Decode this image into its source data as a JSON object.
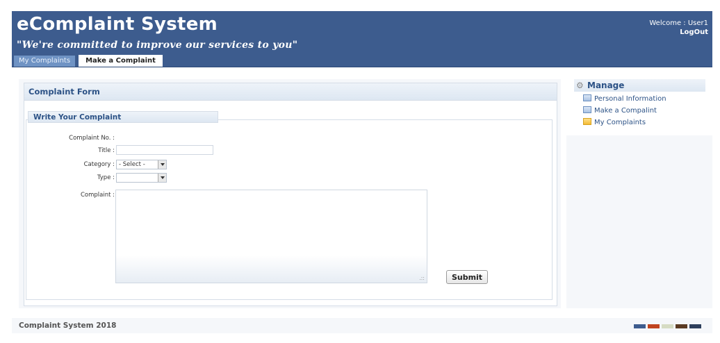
{
  "app": {
    "title": "eComplaint System",
    "slogan": "\"We're committed to improve our services to you\""
  },
  "user": {
    "welcome": "Welcome : User1",
    "logout": "LogOut"
  },
  "tabs": [
    {
      "label": "My Complaints",
      "active": false
    },
    {
      "label": "Make a Complaint",
      "active": true
    }
  ],
  "form": {
    "panel_title": "Complaint Form",
    "section_title": "Write Your Complaint",
    "fields": {
      "complaint_no": {
        "label": "Complaint No. :",
        "value": ""
      },
      "title": {
        "label": "Title :",
        "value": ""
      },
      "category": {
        "label": "Category :",
        "selected": "- Select -"
      },
      "type": {
        "label": "Type :",
        "selected": ""
      },
      "complaint": {
        "label": "Complaint :",
        "value": ""
      }
    },
    "submit_label": "Submit"
  },
  "sidebar": {
    "title": "Manage",
    "items": [
      {
        "label": "Personal Information",
        "icon": "document-icon"
      },
      {
        "label": "Make a Compalint",
        "icon": "document-icon"
      },
      {
        "label": "My Complaints",
        "icon": "folder-icon"
      }
    ]
  },
  "footer": {
    "text": "Complaint System 2018",
    "swatch_colors": [
      "#3d5c8e",
      "#c0441e",
      "#d6dcc4",
      "#5a3a22",
      "#2e3f5c"
    ]
  },
  "colors": {
    "header_bg": "#3d5c8e",
    "accent_text": "#2c5286",
    "tab_inactive": "#6f93c4"
  }
}
